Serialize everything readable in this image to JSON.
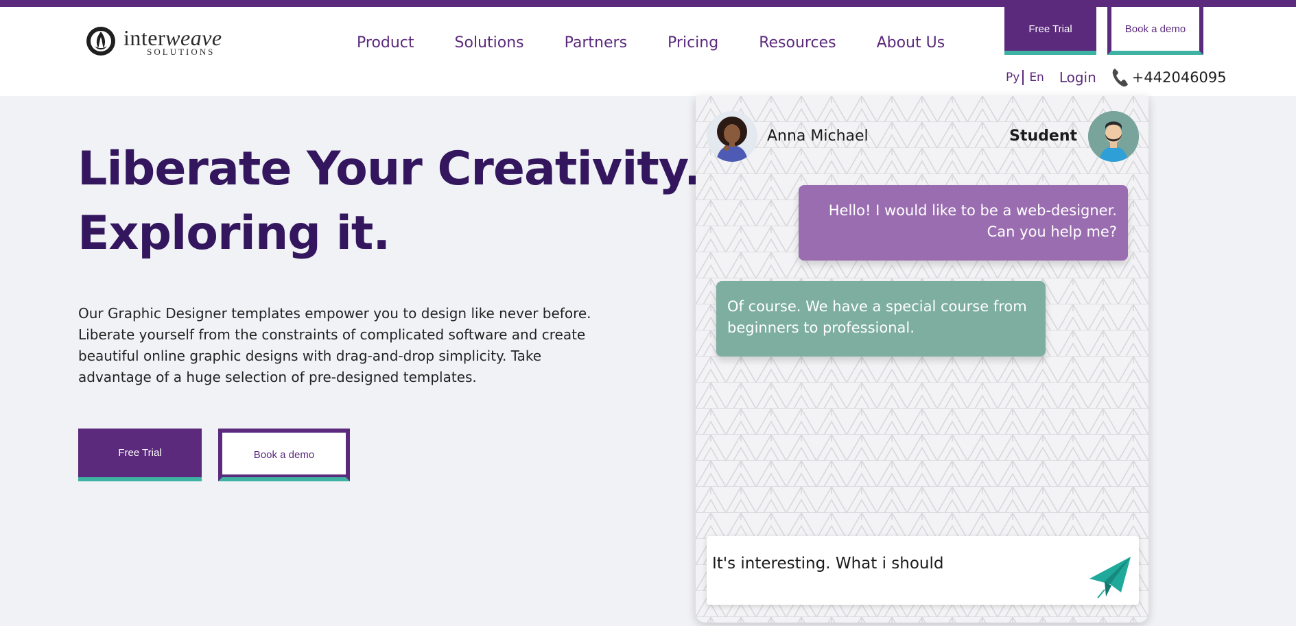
{
  "brand": {
    "name_part1": "inter",
    "name_part2": "weave",
    "tagline": "SOLUTIONS"
  },
  "nav": {
    "items": [
      {
        "label": "Product"
      },
      {
        "label": "Solutions"
      },
      {
        "label": "Partners"
      },
      {
        "label": "Pricing"
      },
      {
        "label": "Resources"
      },
      {
        "label": "About Us"
      }
    ]
  },
  "header": {
    "free_trial_label": "Free Trial",
    "book_demo_label": "Book a demo",
    "lang_ru": "Py",
    "lang_en": "En",
    "login_label": "Login",
    "phone": "+442046095",
    "phone_icon": "phone-icon"
  },
  "hero": {
    "title_line1": "Liberate Your Creativity.",
    "title_line2": "Exploring it.",
    "description": "Our Graphic Designer templates empower you to design like never before. Liberate yourself from the constraints of complicated software and create beautiful online graphic designs with drag-and-drop simplicity. Take advantage of a huge selection of pre-designed templates.",
    "free_trial_label": "Free Trial",
    "book_demo_label": "Book a demo"
  },
  "chat": {
    "left_user": "Anna Michael",
    "right_user": "Student",
    "messages": [
      {
        "text": "Hello! I would like to be a web-designer. Can you help me?"
      },
      {
        "text": "Of course. We have a special course from beginners to professional."
      }
    ],
    "composer_value": "It's interesting. What i should",
    "send_icon": "paper-plane-icon"
  },
  "colors": {
    "brand_purple": "#5b2a7c",
    "accent_teal": "#3fb3a3",
    "title_purple": "#33165e",
    "bubble_purple": "#9a6db0",
    "bubble_green": "#7dae9f",
    "background": "#f1f2f5"
  }
}
